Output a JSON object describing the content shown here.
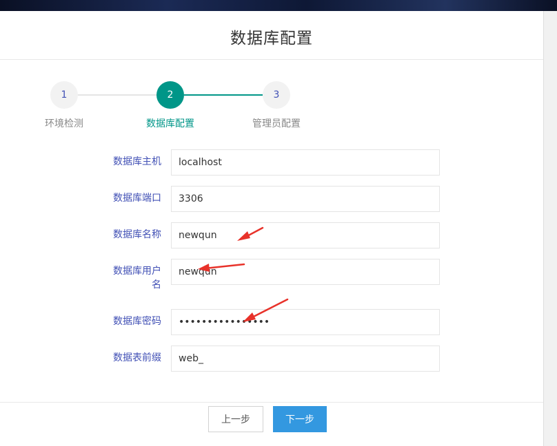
{
  "page": {
    "title": "数据库配置"
  },
  "steps": [
    {
      "number": "1",
      "label": "环境检测",
      "active": false
    },
    {
      "number": "2",
      "label": "数据库配置",
      "active": true
    },
    {
      "number": "3",
      "label": "管理员配置",
      "active": false
    }
  ],
  "form": {
    "host": {
      "label": "数据库主机",
      "value": "localhost"
    },
    "port": {
      "label": "数据库端口",
      "value": "3306"
    },
    "name": {
      "label": "数据库名称",
      "value": "newqun"
    },
    "user": {
      "label_line1": "数据库用户",
      "label_line2": "名",
      "value": "newqun"
    },
    "password": {
      "label": "数据库密码",
      "value": "••••••••••••••••"
    },
    "prefix": {
      "label": "数据表前缀",
      "value": "web_"
    }
  },
  "buttons": {
    "prev": "上一步",
    "next": "下一步"
  },
  "colors": {
    "accent": "#009688",
    "label": "#4150b5",
    "next_button": "#3398e0",
    "annotation_arrow": "#e8322a"
  }
}
